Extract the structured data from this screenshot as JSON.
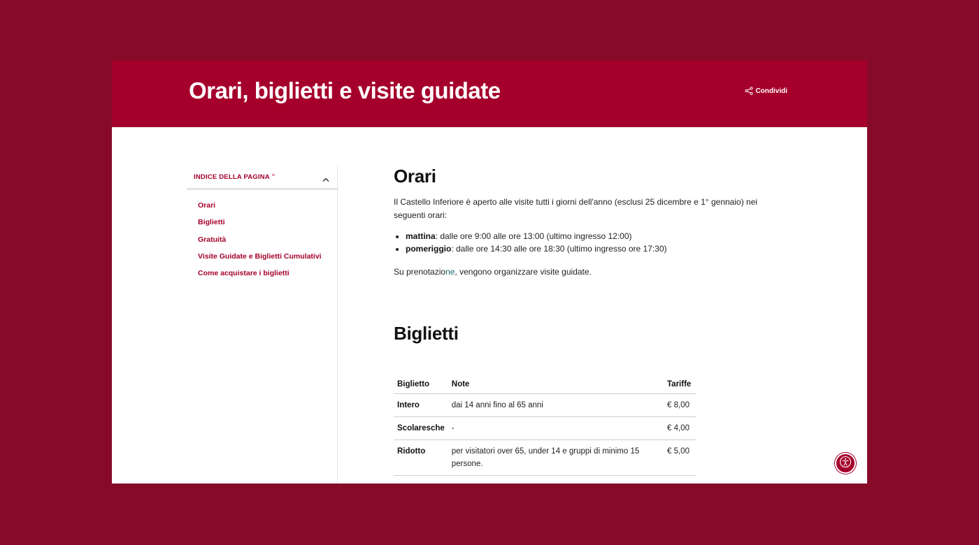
{
  "colors": {
    "primary": "#a5002b",
    "background": "#870b29",
    "link": "#1b6a78"
  },
  "header": {
    "title": "Orari, biglietti e visite guidate",
    "share_label": "Condividi",
    "share_icon": "share-icon"
  },
  "toc": {
    "title": "INDICE DELLA PAGINA",
    "caret": "^",
    "toggle_icon": "chevron-up-icon",
    "items": [
      {
        "label": "Orari"
      },
      {
        "label": "Biglietti"
      },
      {
        "label": "Gratuità"
      },
      {
        "label": "Visite Guidate e Biglietti Cumulativi"
      },
      {
        "label": "Come acquistare i biglietti"
      }
    ]
  },
  "orari": {
    "heading": "Orari",
    "intro": "Il Castello Inferiore è aperto alle visite tutti i giorni dell'anno (esclusi 25 dicembre e 1° gennaio) nei seguenti orari:",
    "hours": [
      {
        "label": "mattina",
        "text": ": dalle ore 9:00 alle ore 13:00 (ultimo ingresso 12:00)"
      },
      {
        "label": "pomeriggio",
        "text": ": dalle ore 14:30 alle ore 18:30 (ultimo ingresso ore 17:30)"
      }
    ],
    "note_before": "Su prenotazio",
    "note_link": "ne",
    "note_after": ", vengono organizzare visite guidate."
  },
  "biglietti": {
    "heading": "Biglietti",
    "columns": [
      "Biglietto",
      "Note",
      "Tariffe"
    ],
    "rows": [
      {
        "name": "Intero",
        "note": "dai 14 anni fino al 65 anni",
        "price": "€ 8,00"
      },
      {
        "name": "Scolaresche",
        "note": "-",
        "price": "€ 4,00"
      },
      {
        "name": "Ridotto",
        "note": "per visitatori over 65, under 14 e gruppi di minimo 15 persone.",
        "price": "€ 5,00"
      }
    ]
  },
  "accessibility": {
    "icon": "accessibility-icon"
  }
}
